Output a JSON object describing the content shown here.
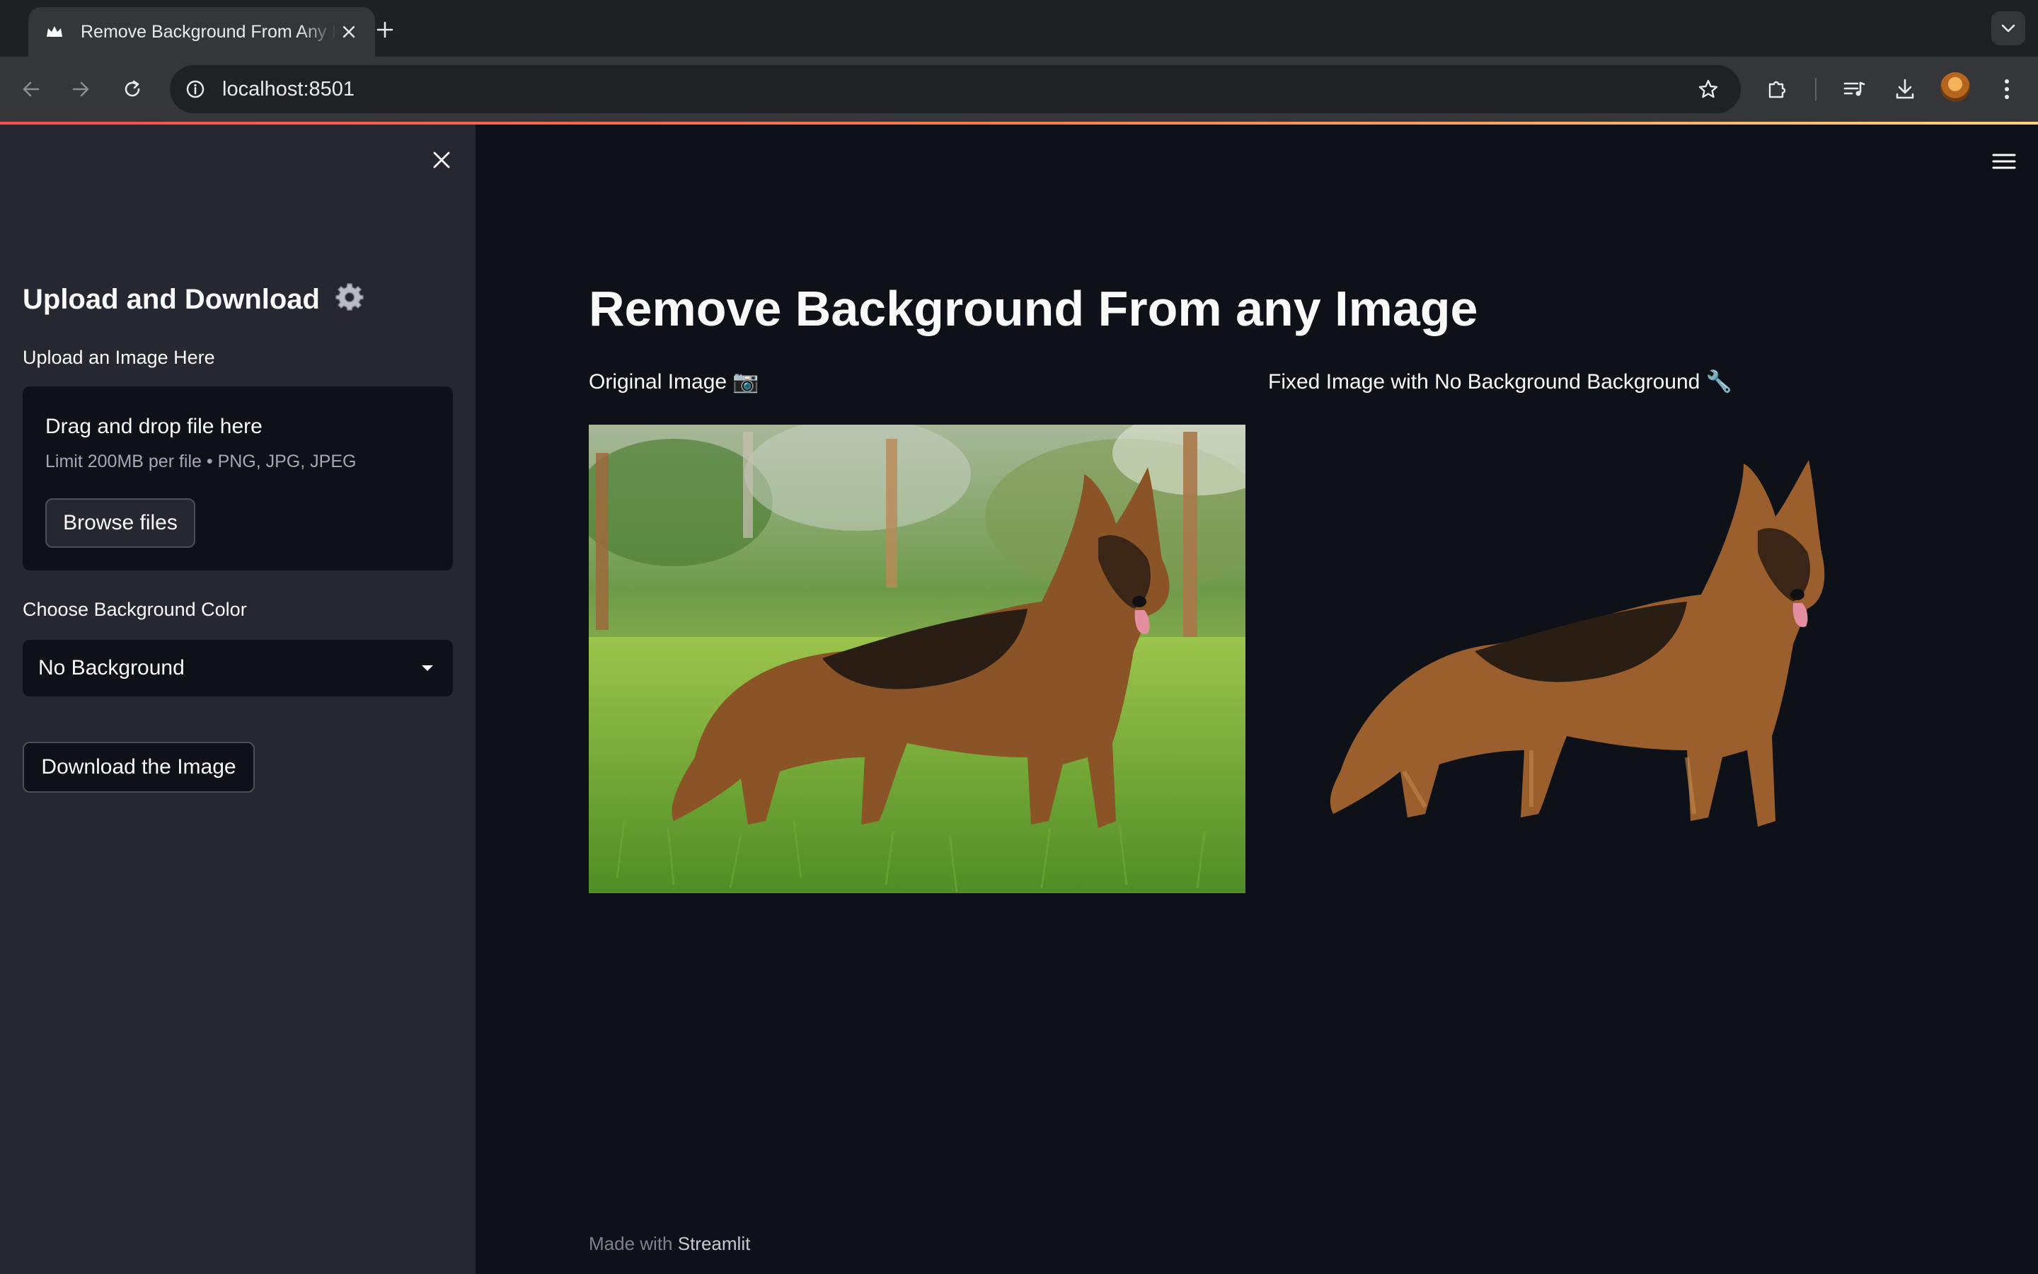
{
  "browser": {
    "tab_title": "Remove Background From Any Image",
    "url": "localhost:8501"
  },
  "sidebar": {
    "heading": "Upload and Download",
    "upload_label": "Upload an Image Here",
    "uploader": {
      "title": "Drag and drop file here",
      "limit": "Limit 200MB per file • PNG, JPG, JPEG",
      "browse_label": "Browse files"
    },
    "bg_color_label": "Choose Background Color",
    "bg_color_selected": "No Background",
    "download_label": "Download the Image"
  },
  "main": {
    "title": "Remove Background From any Image",
    "original_caption": "Original Image 📷",
    "fixed_caption": "Fixed Image with No Background Background 🔧"
  },
  "footer": {
    "prefix": "Made with",
    "brand": "Streamlit"
  },
  "colors": {
    "app_bg": "#0e1117",
    "sidebar_bg": "#262730",
    "accent": "#ff4b4b",
    "text": "#fafafa"
  }
}
